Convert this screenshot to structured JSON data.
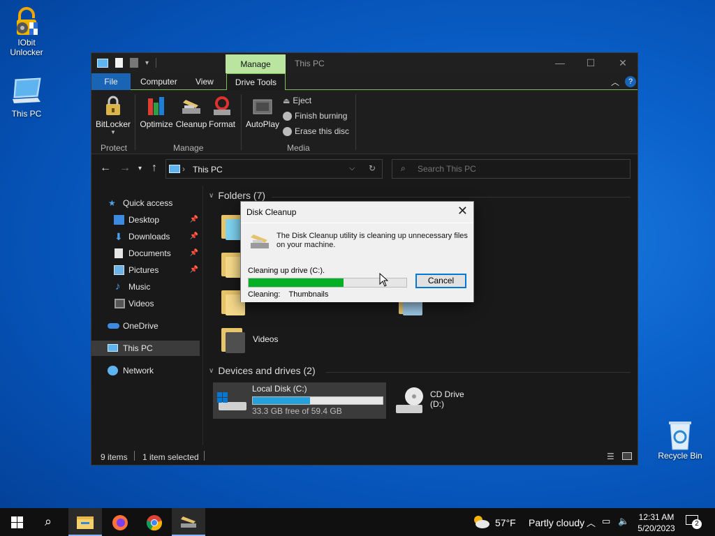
{
  "desktop": {
    "icons": [
      {
        "label": "IObit Unlocker"
      },
      {
        "label": "This PC"
      },
      {
        "label": "Recycle Bin"
      }
    ]
  },
  "explorer": {
    "context_tab": "Manage",
    "title": "This PC",
    "ribbon_tabs": [
      "File",
      "Computer",
      "View",
      "Drive Tools"
    ],
    "buttons": {
      "bitlocker": "BitLocker",
      "optimize": "Optimize",
      "cleanup": "Cleanup",
      "format": "Format",
      "autoplay": "AutoPlay",
      "eject": "Eject",
      "finish_burning": "Finish burning",
      "erase_disc": "Erase this disc"
    },
    "groups": {
      "protect": "Protect",
      "manage": "Manage",
      "media": "Media"
    },
    "address": "This PC",
    "search_placeholder": "Search This PC",
    "nav": {
      "quick_access": "Quick access",
      "desktop": "Desktop",
      "downloads": "Downloads",
      "documents": "Documents",
      "pictures": "Pictures",
      "music": "Music",
      "videos": "Videos",
      "onedrive": "OneDrive",
      "this_pc": "This PC",
      "network": "Network"
    },
    "folders_header": "Folders (7)",
    "videos_folder": "Videos",
    "devices_header": "Devices and drives (2)",
    "drive_c": {
      "name": "Local Disk (C:)",
      "free_text": "33.3 GB free of 59.4 GB",
      "used_fraction": 0.44
    },
    "drive_d": {
      "name": "CD Drive (D:)"
    },
    "status": {
      "items": "9 items",
      "selected": "1 item selected"
    }
  },
  "dialog": {
    "title": "Disk Cleanup",
    "message": "The Disk Cleanup utility is cleaning up unnecessary files on your machine.",
    "drive_text": "Cleaning up drive  (C:).",
    "progress_fraction": 0.6,
    "cancel_label": "Cancel",
    "cleaning_label": "Cleaning:",
    "cleaning_item": "Thumbnails"
  },
  "taskbar": {
    "weather_temp": "57°F",
    "weather_desc": "Partly cloudy",
    "time": "12:31 AM",
    "date": "5/20/2023",
    "notification_count": "2"
  },
  "colors": {
    "progress_green": "#06b025",
    "drive_bar_blue": "#26a0da",
    "manage_tab_green": "#b9e5a0",
    "file_tab_blue": "#1a64b5"
  }
}
